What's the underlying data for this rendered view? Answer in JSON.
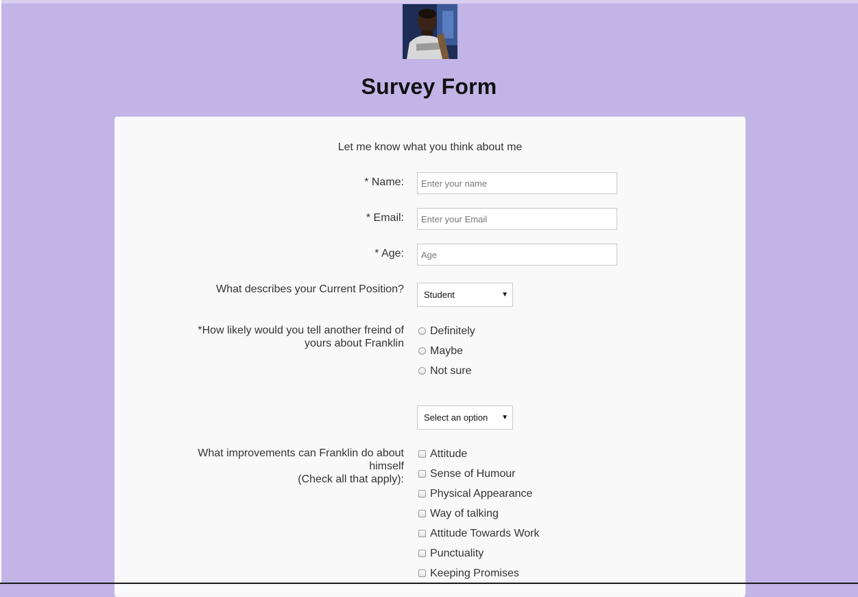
{
  "page": {
    "title": "Survey Form",
    "description": "Let me know what you think about me"
  },
  "fields": {
    "name": {
      "label": "* Name:",
      "placeholder": "Enter your name",
      "value": ""
    },
    "email": {
      "label": "* Email:",
      "placeholder": "Enter your Email",
      "value": ""
    },
    "age": {
      "label": "* Age:",
      "placeholder": "Age",
      "value": ""
    },
    "position": {
      "label": "What describes your Current Position?",
      "selected": "Student"
    },
    "recommend": {
      "label_line1": "*How likely would you tell another freind of",
      "label_line2": "yours about Franklin",
      "options": [
        "Definitely",
        "Maybe",
        "Not sure"
      ]
    },
    "extra_select": {
      "selected": "Select an option"
    },
    "improvements": {
      "label_line1": "What improvements can Franklin do about",
      "label_line2": "himself",
      "label_line3": "(Check all that apply):",
      "options": [
        "Attitude",
        "Sense of Humour",
        "Physical Appearance",
        "Way of talking",
        "Attitude Towards Work",
        "Punctuality",
        "Keeping Promises"
      ]
    }
  },
  "colors": {
    "background": "#c2b4e6",
    "card": "#f9f9f9"
  },
  "icons": {
    "dropdown": "caret-down-icon"
  }
}
